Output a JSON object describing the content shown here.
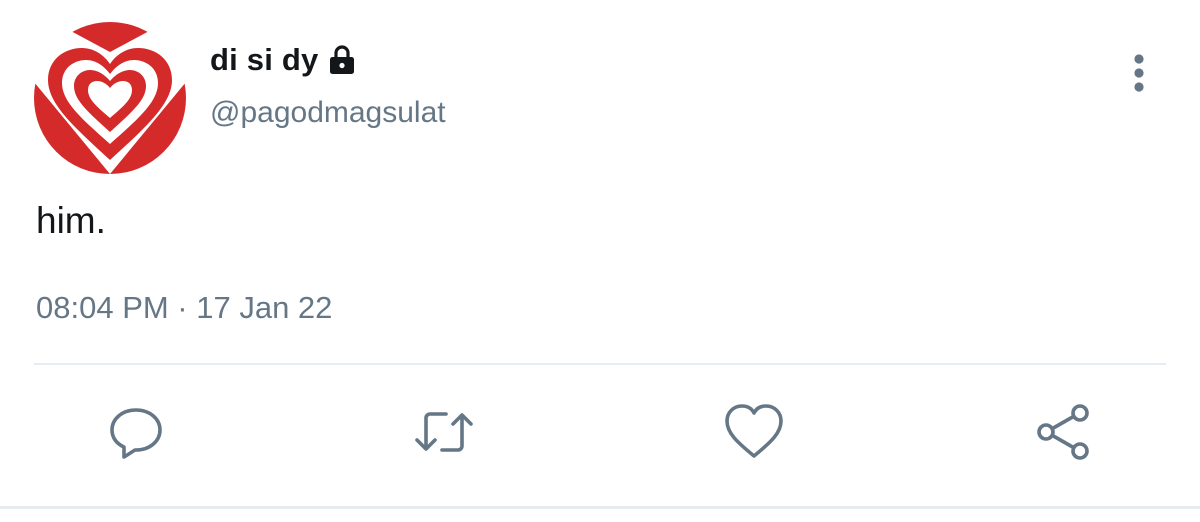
{
  "user": {
    "display_name": "di si dy",
    "handle": "@pagodmagsulat",
    "protected_icon": "lock-icon",
    "avatar_icon": "heart-avatar"
  },
  "tweet": {
    "text": "him.",
    "timestamp": "08:04 PM · 17 Jan 22"
  },
  "actions": [
    {
      "name": "reply",
      "icon": "reply-icon"
    },
    {
      "name": "retweet",
      "icon": "retweet-icon"
    },
    {
      "name": "like",
      "icon": "heart-icon"
    },
    {
      "name": "share",
      "icon": "share-icon"
    }
  ],
  "menu_icon": "more-vertical-icon",
  "colors": {
    "text_primary": "#14171a",
    "text_secondary": "#657786",
    "icon_gray": "#657786",
    "divider": "#e6ecf0",
    "avatar_red": "#d42a2a"
  }
}
